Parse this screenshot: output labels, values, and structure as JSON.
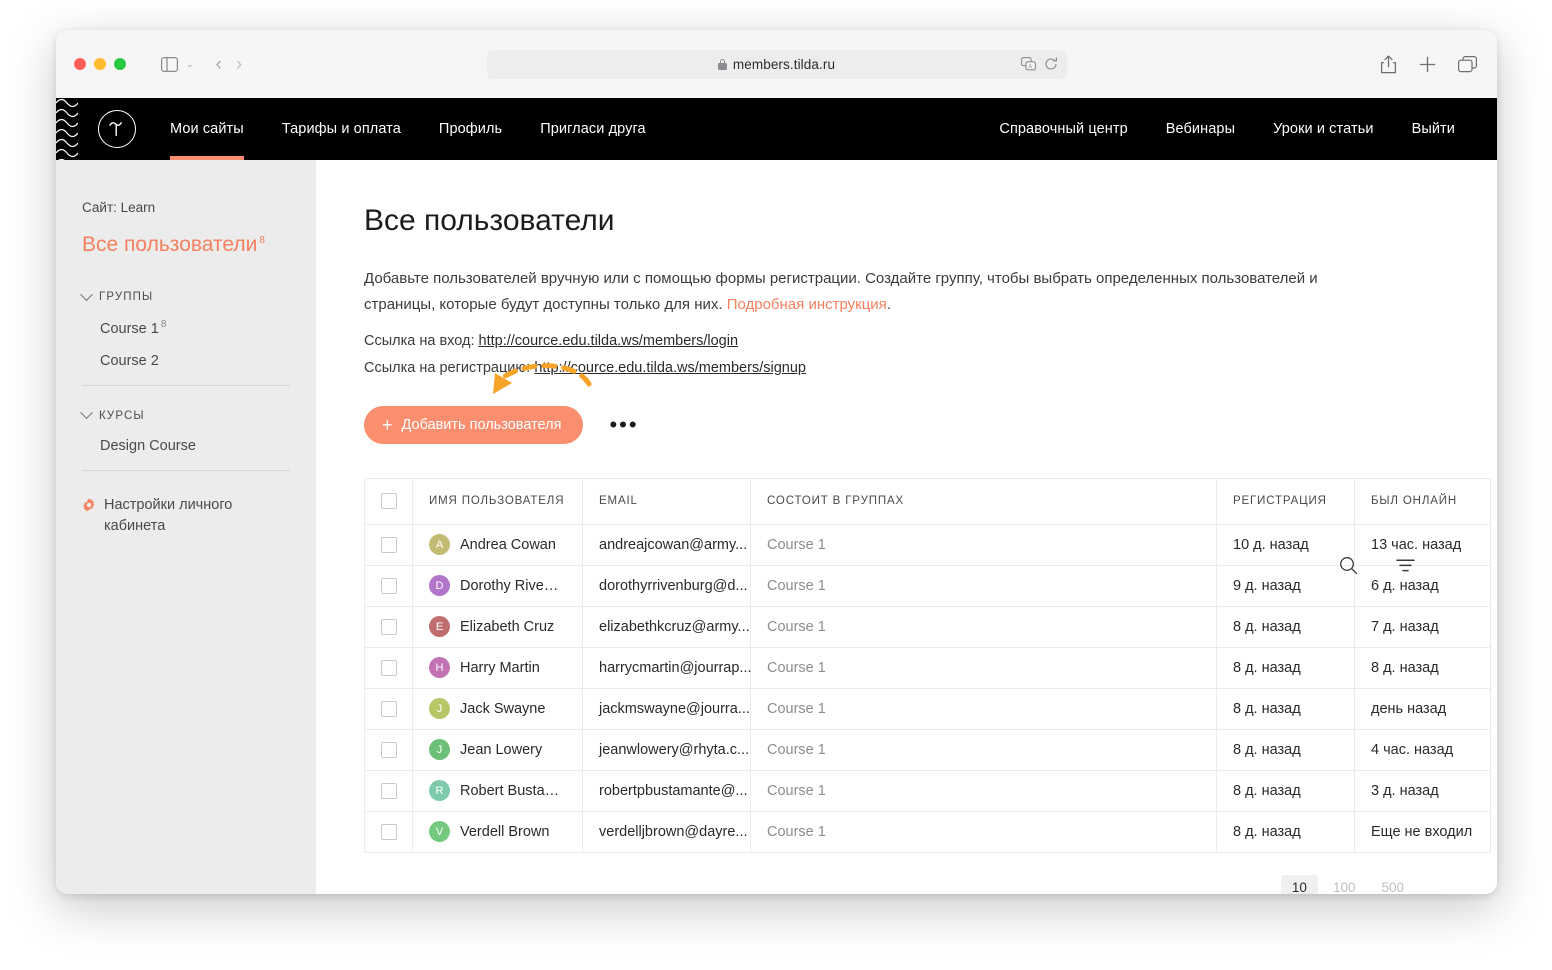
{
  "browser": {
    "url": "members.tilda.ru",
    "lock_icon": "lock-icon",
    "translate_icon": "translate-icon",
    "reload_icon": "reload-icon",
    "share_icon": "share-icon",
    "new_tab_icon": "plus-icon",
    "tabs_icon": "tab-overview-icon",
    "sidebar_icon": "sidebar-toggle-icon",
    "back_arrow": "‹",
    "forward_arrow": "›",
    "chevron": "⌄"
  },
  "topnav": {
    "logo_name": "tilda-logo",
    "left_items": [
      {
        "label": "Мои сайты",
        "active": true
      },
      {
        "label": "Тарифы и оплата",
        "active": false
      },
      {
        "label": "Профиль",
        "active": false
      },
      {
        "label": "Пригласи друга",
        "active": false
      }
    ],
    "right_items": [
      {
        "label": "Справочный центр"
      },
      {
        "label": "Вебинары"
      },
      {
        "label": "Уроки и статьи"
      },
      {
        "label": "Выйти"
      }
    ],
    "accent_color": "#fa8e6f"
  },
  "sidebar": {
    "site_label": "Сайт: Learn",
    "all_users": {
      "label": "Все пользователи",
      "count": "8"
    },
    "groups_section": {
      "title": "ГРУППЫ",
      "items": [
        {
          "label": "Course 1",
          "count": "8"
        },
        {
          "label": "Course 2",
          "count": ""
        }
      ]
    },
    "courses_section": {
      "title": "КУРСЫ",
      "items": [
        {
          "label": "Design Course",
          "count": ""
        }
      ]
    },
    "settings": {
      "label": "Настройки личного кабинета",
      "icon": "gear-icon"
    },
    "active_color": "#f5805f"
  },
  "main": {
    "title": "Все пользователи",
    "description_part1": "Добавьте пользователей вручную или с помощью формы регистрации. Создайте группу, чтобы выбрать определенных пользователей и страницы, которые будут доступны только для них. ",
    "description_link": "Подробная инструкция",
    "description_part2": ".",
    "login_label": "Ссылка на вход: ",
    "login_url": "http://cource.edu.tilda.ws/members/login",
    "signup_label": "Ссылка на регистрацию: ",
    "signup_url": "http://cource.edu.tilda.ws/members/signup",
    "add_button": "Добавить пользователя",
    "more_dots": "•••",
    "search_icon": "search-icon",
    "filter_icon": "filter-icon",
    "annotation_arrow": "curved-dashed-arrow",
    "annotation_color": "#f7a428"
  },
  "table": {
    "columns": [
      "ИМЯ ПОЛЬЗОВАТЕЛЯ",
      "EMAIL",
      "СОСТОИТ В ГРУППАХ",
      "РЕГИСТРАЦИЯ",
      "БЫЛ ОНЛАЙН"
    ],
    "rows": [
      {
        "initial": "A",
        "color": "#c3bb74",
        "name": "Andrea Cowan",
        "email": "andreajcowan@army...",
        "groups": "Course 1",
        "registered": "10 д. назад",
        "online": "13 час. назад"
      },
      {
        "initial": "D",
        "color": "#b175c9",
        "name": "Dorothy Rivenburg",
        "email": "dorothyrrivenburg@d...",
        "groups": "Course 1",
        "registered": "9 д. назад",
        "online": "6 д. назад"
      },
      {
        "initial": "E",
        "color": "#c06d6d",
        "name": "Elizabeth Cruz",
        "email": "elizabethkcruz@army...",
        "groups": "Course 1",
        "registered": "8 д. назад",
        "online": "7 д. назад"
      },
      {
        "initial": "H",
        "color": "#c372b4",
        "name": "Harry Martin",
        "email": "harrycmartin@jourrap...",
        "groups": "Course 1",
        "registered": "8 д. назад",
        "online": "8 д. назад"
      },
      {
        "initial": "J",
        "color": "#b7c667",
        "name": "Jack Swayne",
        "email": "jackmswayne@jourra...",
        "groups": "Course 1",
        "registered": "8 д. назад",
        "online": "день назад"
      },
      {
        "initial": "J",
        "color": "#6cbf77",
        "name": "Jean Lowery",
        "email": "jeanwlowery@rhyta.c...",
        "groups": "Course 1",
        "registered": "8 д. назад",
        "online": "4 час. назад"
      },
      {
        "initial": "R",
        "color": "#7ecbac",
        "name": "Robert Bustamante",
        "email": "robertpbustamante@...",
        "groups": "Course 1",
        "registered": "8 д. назад",
        "online": "3 д. назад"
      },
      {
        "initial": "V",
        "color": "#74c97f",
        "name": "Verdell Brown",
        "email": "verdelljbrown@dayre...",
        "groups": "Course 1",
        "registered": "8 д. назад",
        "online": "Еще не входил"
      }
    ]
  },
  "pagination": {
    "options": [
      {
        "label": "10",
        "active": true
      },
      {
        "label": "100",
        "active": false
      },
      {
        "label": "500",
        "active": false
      }
    ]
  }
}
